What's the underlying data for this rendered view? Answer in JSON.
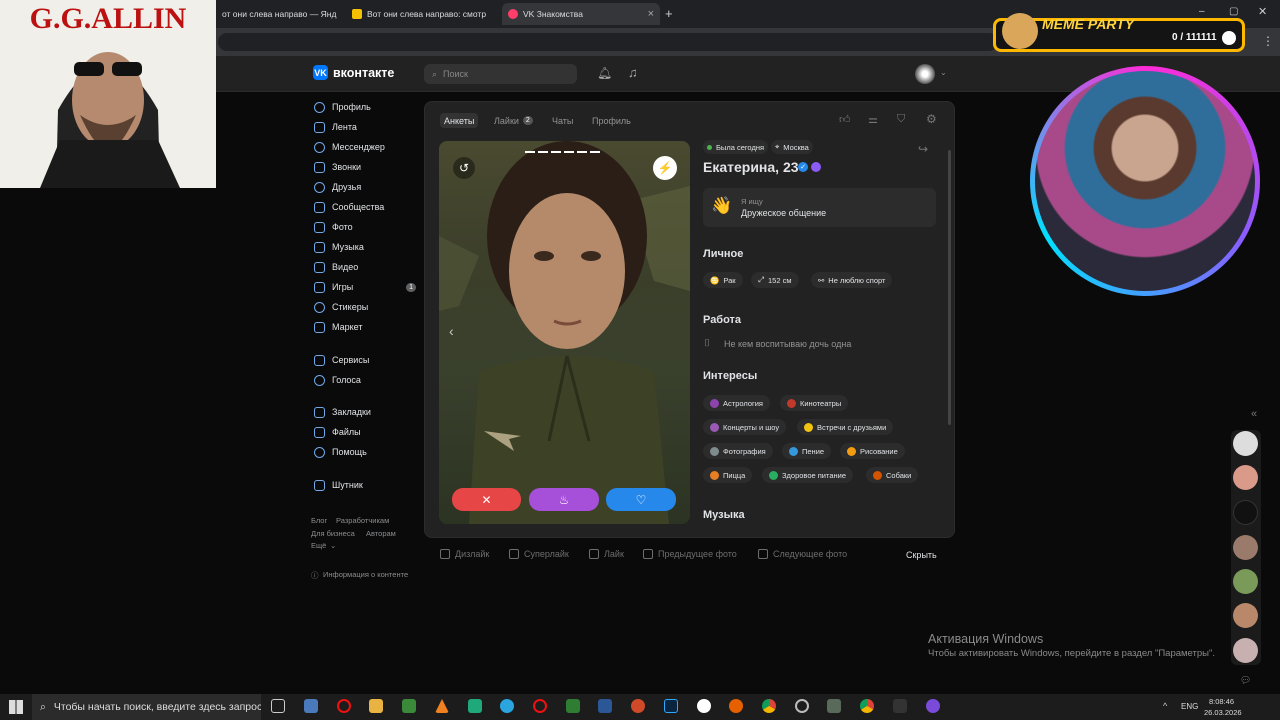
{
  "browser": {
    "tabs": [
      {
        "label": "от они слева направо — Янд"
      },
      {
        "label": "Вот они слева направо: смотр"
      },
      {
        "label": "VK Знакомства"
      }
    ]
  },
  "overlay": {
    "poster_text": "G.G.ALLIN",
    "meme_party": "MEME PARTY",
    "counter": "0 / 111111"
  },
  "vk": {
    "logo": "вконтакте",
    "search_placeholder": "Поиск",
    "nav": [
      {
        "label": "Профиль"
      },
      {
        "label": "Лента"
      },
      {
        "label": "Мессенджер"
      },
      {
        "label": "Звонки"
      },
      {
        "label": "Друзья"
      },
      {
        "label": "Сообщества"
      },
      {
        "label": "Фото"
      },
      {
        "label": "Музыка"
      },
      {
        "label": "Видео"
      },
      {
        "label": "Игры",
        "count": "1"
      },
      {
        "label": "Стикеры"
      },
      {
        "label": "Маркет"
      },
      {
        "label": "Сервисы"
      },
      {
        "label": "Голоса"
      },
      {
        "label": "Закладки"
      },
      {
        "label": "Файлы"
      },
      {
        "label": "Помощь"
      },
      {
        "label": "Шутник"
      }
    ],
    "footer": {
      "blog": "Блог",
      "developers": "Разработчикам",
      "business": "Для бизнеса",
      "authors": "Авторам",
      "more": "Ещё",
      "info": "Информация о контенте"
    }
  },
  "dating": {
    "tabs": [
      {
        "label": "Анкеты"
      },
      {
        "label": "Лайки",
        "count": "2"
      },
      {
        "label": "Чаты"
      },
      {
        "label": "Профиль"
      }
    ],
    "status": "Была сегодня",
    "city": "Москва",
    "name": "Екатерина, 23",
    "looking_label": "Я ищу",
    "looking_value": "Дружеское общение",
    "personal_title": "Личное",
    "personal": [
      "Рак",
      "152 см",
      "Не люблю спорт"
    ],
    "work_title": "Работа",
    "work": "Не кем воспитываю дочь одна",
    "interests_title": "Интересы",
    "interests": [
      {
        "label": "Астрология",
        "color": "#8e44ad"
      },
      {
        "label": "Кинотеатры",
        "color": "#c0392b"
      },
      {
        "label": "Концерты и шоу",
        "color": "#9b59b6"
      },
      {
        "label": "Встречи с друзьями",
        "color": "#f1c40f"
      },
      {
        "label": "Фотография",
        "color": "#7f8c8d"
      },
      {
        "label": "Пение",
        "color": "#3498db"
      },
      {
        "label": "Рисование",
        "color": "#f39c12"
      },
      {
        "label": "Пицца",
        "color": "#e67e22"
      },
      {
        "label": "Здоровое питание",
        "color": "#27ae60"
      },
      {
        "label": "Собаки",
        "color": "#d35400"
      }
    ],
    "music_title": "Музыка",
    "actions": [
      "Дизлайк",
      "Суперлайк",
      "Лайк",
      "Предыдущее фото",
      "Следующее фото"
    ],
    "hide": "Скрыть"
  },
  "watermark": {
    "title": "Активация Windows",
    "subtitle": "Чтобы активировать Windows, перейдите в раздел \"Параметры\"."
  },
  "taskbar": {
    "search": "Чтобы начать поиск, введите здесь запрос",
    "lang": "ENG",
    "time": "8:08:46",
    "date": "26.03.2026"
  }
}
